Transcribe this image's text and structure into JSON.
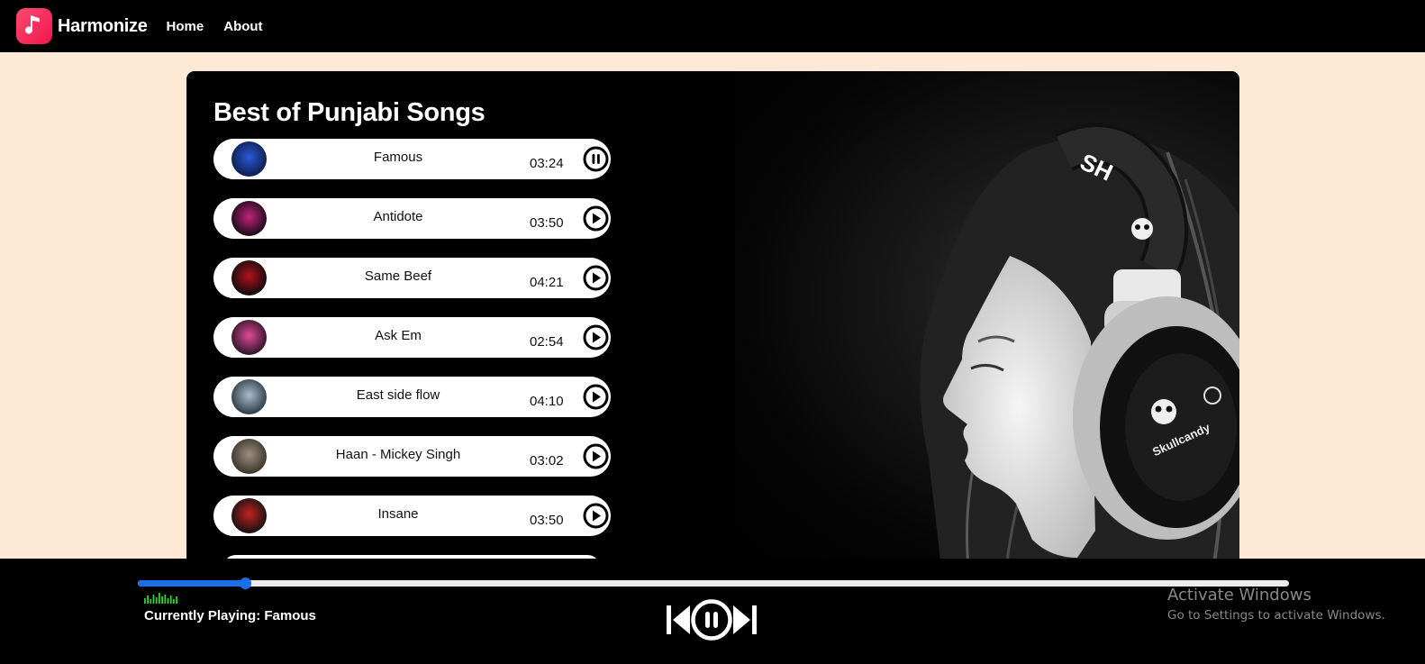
{
  "navbar": {
    "brand": "Harmonize",
    "links": [
      "Home",
      "About"
    ]
  },
  "main": {
    "title": "Best of Punjabi Songs",
    "songs": [
      {
        "name": "Famous",
        "time": "03:24",
        "state": "pause",
        "cover_colors": [
          "#0c1c4a",
          "#2b5ad8"
        ]
      },
      {
        "name": "Antidote",
        "time": "03:50",
        "state": "play",
        "cover_colors": [
          "#150a17",
          "#c2247a"
        ]
      },
      {
        "name": "Same Beef",
        "time": "04:21",
        "state": "play",
        "cover_colors": [
          "#0b0b0b",
          "#b3121c"
        ]
      },
      {
        "name": "Ask Em",
        "time": "02:54",
        "state": "play",
        "cover_colors": [
          "#2a1424",
          "#e04a98"
        ]
      },
      {
        "name": "East side flow",
        "time": "04:10",
        "state": "play",
        "cover_colors": [
          "#2c3a44",
          "#a8bccc"
        ]
      },
      {
        "name": "Haan - Mickey Singh",
        "time": "03:02",
        "state": "play",
        "cover_colors": [
          "#3a332b",
          "#9c8f7e"
        ]
      },
      {
        "name": "Insane",
        "time": "03:50",
        "state": "play",
        "cover_colors": [
          "#111111",
          "#c42121"
        ]
      }
    ]
  },
  "player": {
    "current_label": "Currently Playing: Famous",
    "progress": 0.093,
    "accent": "#1a6fe8",
    "eq_color": "#2fd12f"
  },
  "watermark": {
    "title": "Activate Windows",
    "subtitle": "Go to Settings to activate Windows."
  },
  "icons": {
    "logo": "music-note-icon",
    "song_play": "play-circle-icon",
    "song_pause": "pause-circle-icon",
    "prev": "skip-previous-icon",
    "play_pause": "pause-circle-icon",
    "next": "skip-next-icon"
  }
}
